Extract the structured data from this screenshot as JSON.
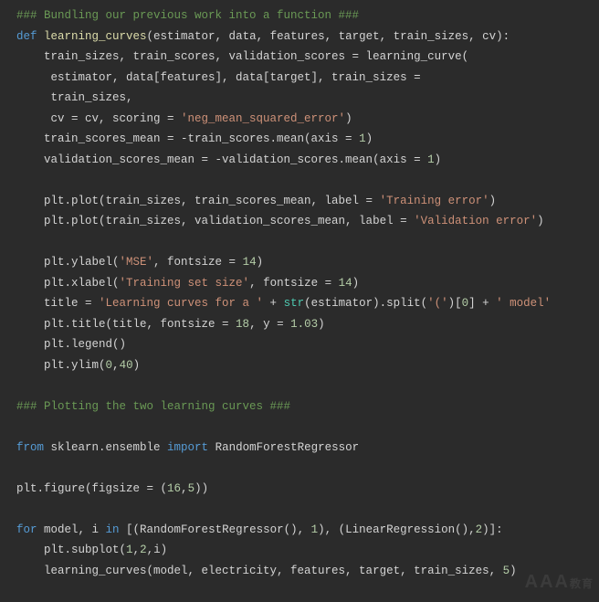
{
  "lines": [
    [
      [
        "comment",
        "### Bundling our previous work into a function ###"
      ]
    ],
    [
      [
        "keyword",
        "def "
      ],
      [
        "func",
        "learning_curves"
      ],
      [
        "default",
        "(estimator, data, features, target, train_sizes, cv):"
      ]
    ],
    [
      [
        "default",
        "    train_sizes, train_scores, validation_scores = learning_curve("
      ]
    ],
    [
      [
        "default",
        "     estimator, data[features], data[target], train_sizes ="
      ]
    ],
    [
      [
        "default",
        "     train_sizes,"
      ]
    ],
    [
      [
        "default",
        "     cv = cv, scoring = "
      ],
      [
        "string",
        "'neg_mean_squared_error'"
      ],
      [
        "default",
        ")"
      ]
    ],
    [
      [
        "default",
        "    train_scores_mean = -train_scores.mean(axis = "
      ],
      [
        "number",
        "1"
      ],
      [
        "default",
        ")"
      ]
    ],
    [
      [
        "default",
        "    validation_scores_mean = -validation_scores.mean(axis = "
      ],
      [
        "number",
        "1"
      ],
      [
        "default",
        ")"
      ]
    ],
    [
      [
        "default",
        ""
      ]
    ],
    [
      [
        "default",
        "    plt.plot(train_sizes, train_scores_mean, label = "
      ],
      [
        "string",
        "'Training error'"
      ],
      [
        "default",
        ")"
      ]
    ],
    [
      [
        "default",
        "    plt.plot(train_sizes, validation_scores_mean, label = "
      ],
      [
        "string",
        "'Validation error'"
      ],
      [
        "default",
        ")"
      ]
    ],
    [
      [
        "default",
        ""
      ]
    ],
    [
      [
        "default",
        "    plt.ylabel("
      ],
      [
        "string",
        "'MSE'"
      ],
      [
        "default",
        ", fontsize = "
      ],
      [
        "number",
        "14"
      ],
      [
        "default",
        ")"
      ]
    ],
    [
      [
        "default",
        "    plt.xlabel("
      ],
      [
        "string",
        "'Training set size'"
      ],
      [
        "default",
        ", fontsize = "
      ],
      [
        "number",
        "14"
      ],
      [
        "default",
        ")"
      ]
    ],
    [
      [
        "default",
        "    title = "
      ],
      [
        "string",
        "'Learning curves for a '"
      ],
      [
        "default",
        " + "
      ],
      [
        "type",
        "str"
      ],
      [
        "default",
        "(estimator).split("
      ],
      [
        "string",
        "'('"
      ],
      [
        "default",
        ")["
      ],
      [
        "number",
        "0"
      ],
      [
        "default",
        "] + "
      ],
      [
        "string",
        "' model'"
      ]
    ],
    [
      [
        "default",
        "    plt.title(title, fontsize = "
      ],
      [
        "number",
        "18"
      ],
      [
        "default",
        ", y = "
      ],
      [
        "number",
        "1.03"
      ],
      [
        "default",
        ")"
      ]
    ],
    [
      [
        "default",
        "    plt.legend()"
      ]
    ],
    [
      [
        "default",
        "    plt.ylim("
      ],
      [
        "number",
        "0"
      ],
      [
        "default",
        ","
      ],
      [
        "number",
        "40"
      ],
      [
        "default",
        ")"
      ]
    ],
    [
      [
        "default",
        ""
      ]
    ],
    [
      [
        "comment",
        "### Plotting the two learning curves ###"
      ]
    ],
    [
      [
        "default",
        ""
      ]
    ],
    [
      [
        "keyword",
        "from"
      ],
      [
        "default",
        " sklearn.ensemble "
      ],
      [
        "keyword",
        "import"
      ],
      [
        "default",
        " RandomForestRegressor"
      ]
    ],
    [
      [
        "default",
        ""
      ]
    ],
    [
      [
        "default",
        "plt.figure(figsize = ("
      ],
      [
        "number",
        "16"
      ],
      [
        "default",
        ","
      ],
      [
        "number",
        "5"
      ],
      [
        "default",
        "))"
      ]
    ],
    [
      [
        "default",
        ""
      ]
    ],
    [
      [
        "keyword",
        "for"
      ],
      [
        "default",
        " model, i "
      ],
      [
        "keyword",
        "in"
      ],
      [
        "default",
        " [(RandomForestRegressor(), "
      ],
      [
        "number",
        "1"
      ],
      [
        "default",
        "), (LinearRegression(),"
      ],
      [
        "number",
        "2"
      ],
      [
        "default",
        ")]:"
      ]
    ],
    [
      [
        "default",
        "    plt.subplot("
      ],
      [
        "number",
        "1"
      ],
      [
        "default",
        ","
      ],
      [
        "number",
        "2"
      ],
      [
        "default",
        ",i)"
      ]
    ],
    [
      [
        "default",
        "    learning_curves(model, electricity, features, target, train_sizes, "
      ],
      [
        "number",
        "5"
      ],
      [
        "default",
        ")"
      ]
    ]
  ],
  "watermark": {
    "main": "AAA",
    "sub": "教育"
  },
  "css_class_map": {
    "default": "c-default",
    "comment": "c-comment",
    "keyword": "c-keyword",
    "func": "c-func",
    "string": "c-string",
    "number": "c-number",
    "type": "c-type",
    "param": "c-param"
  }
}
